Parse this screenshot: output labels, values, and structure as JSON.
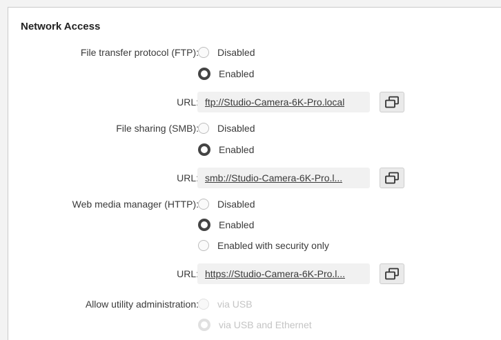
{
  "section": {
    "title": "Network Access"
  },
  "ftp": {
    "label": "File transfer protocol (FTP):",
    "options": [
      "Disabled",
      "Enabled"
    ],
    "selected": "Enabled",
    "url_label": "URL:",
    "url": "ftp://Studio-Camera-6K-Pro.local"
  },
  "smb": {
    "label": "File sharing (SMB):",
    "options": [
      "Disabled",
      "Enabled"
    ],
    "selected": "Enabled",
    "url_label": "URL:",
    "url": "smb://Studio-Camera-6K-Pro.l..."
  },
  "http": {
    "label": "Web media manager (HTTP):",
    "options": [
      "Disabled",
      "Enabled",
      "Enabled with security only"
    ],
    "selected": "Enabled",
    "url_label": "URL:",
    "url": "https://Studio-Camera-6K-Pro.l..."
  },
  "utility": {
    "label": "Allow utility administration:",
    "options": [
      "via USB",
      "via USB and Ethernet"
    ],
    "selected": "via USB and Ethernet",
    "disabled": true
  },
  "icons": {
    "copy": "copy-icon"
  },
  "colors": {
    "panel_bg": "#ffffff",
    "page_bg": "#f3f3f3",
    "radio_checked": "#444444",
    "disabled_text": "#c4c4c4"
  }
}
